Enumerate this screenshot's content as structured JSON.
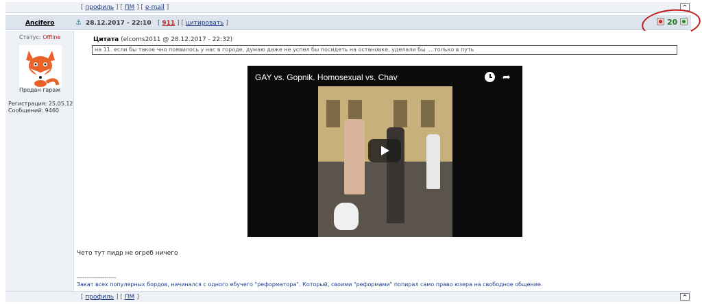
{
  "top_links": {
    "profile": "профиль",
    "pm": "ПМ",
    "email": "e-mail"
  },
  "bottom_links": {
    "profile": "профиль",
    "pm": "ПМ"
  },
  "up_label": "^",
  "post": {
    "author": "Ancifero",
    "date": "28.12.2017 - 22:10",
    "number": "911",
    "cite_label": "цитировать",
    "rating": "20",
    "text": "Чето тут пидр не огреб ничего"
  },
  "user": {
    "status_label": "Статус:",
    "status_value": "Offline",
    "avatar_caption": "Продан гараж",
    "reg_label": "Регистрация:",
    "reg_value": "25.05.12",
    "posts_label": "Сообщений:",
    "posts_value": "9460"
  },
  "quote": {
    "label": "Цитата",
    "source": "(elcoms2011 @ 28.12.2017 - 22:32)",
    "text": "на 11. если бы такое чно появилось у нас в городе, думаю даже не успел бы посидеть на остановке, уделали бы ....только в путь"
  },
  "video": {
    "title": "GAY vs. Gopnik. Homosexual vs. Chav"
  },
  "signature": {
    "separator": "--------------------",
    "text": "Закат всех популярных бордов, начинался с одного ебучего \"реформатора\". Который, своими \"реформами\" попирал само право юзера на свободное общение."
  },
  "icons": {
    "anchor": "anchor-icon",
    "rate_minus": "rate-minus-icon",
    "rate_plus": "rate-plus-icon",
    "play": "play-icon",
    "clock": "watch-later-icon",
    "share": "share-icon"
  },
  "colors": {
    "offline": "#c21a1a",
    "rating": "#1f7a1f",
    "link": "#1c3c8c",
    "annotation_circle": "#c01818"
  }
}
